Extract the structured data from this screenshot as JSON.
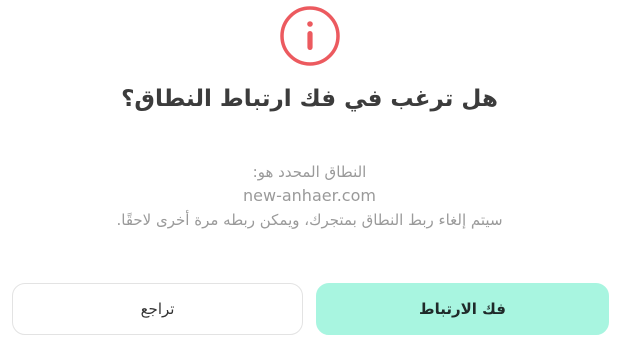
{
  "dialog": {
    "icon": "info-circle-icon",
    "icon_color": "#ec5a5f",
    "title": "هل ترغب في فك ارتباط النطاق؟",
    "domain_label": "النطاق المحدد هو:",
    "domain_value": "new-anhaer.com",
    "note": "سيتم إلغاء ربط النطاق بمتجرك، ويمكن ربطه مرة أخرى لاحقًا.",
    "buttons": {
      "confirm_label": "فك الارتباط",
      "cancel_label": "تراجع"
    },
    "colors": {
      "confirm_bg": "#a8f5e0",
      "title": "#3c3c3c",
      "muted_text": "#9a9a9a"
    }
  }
}
